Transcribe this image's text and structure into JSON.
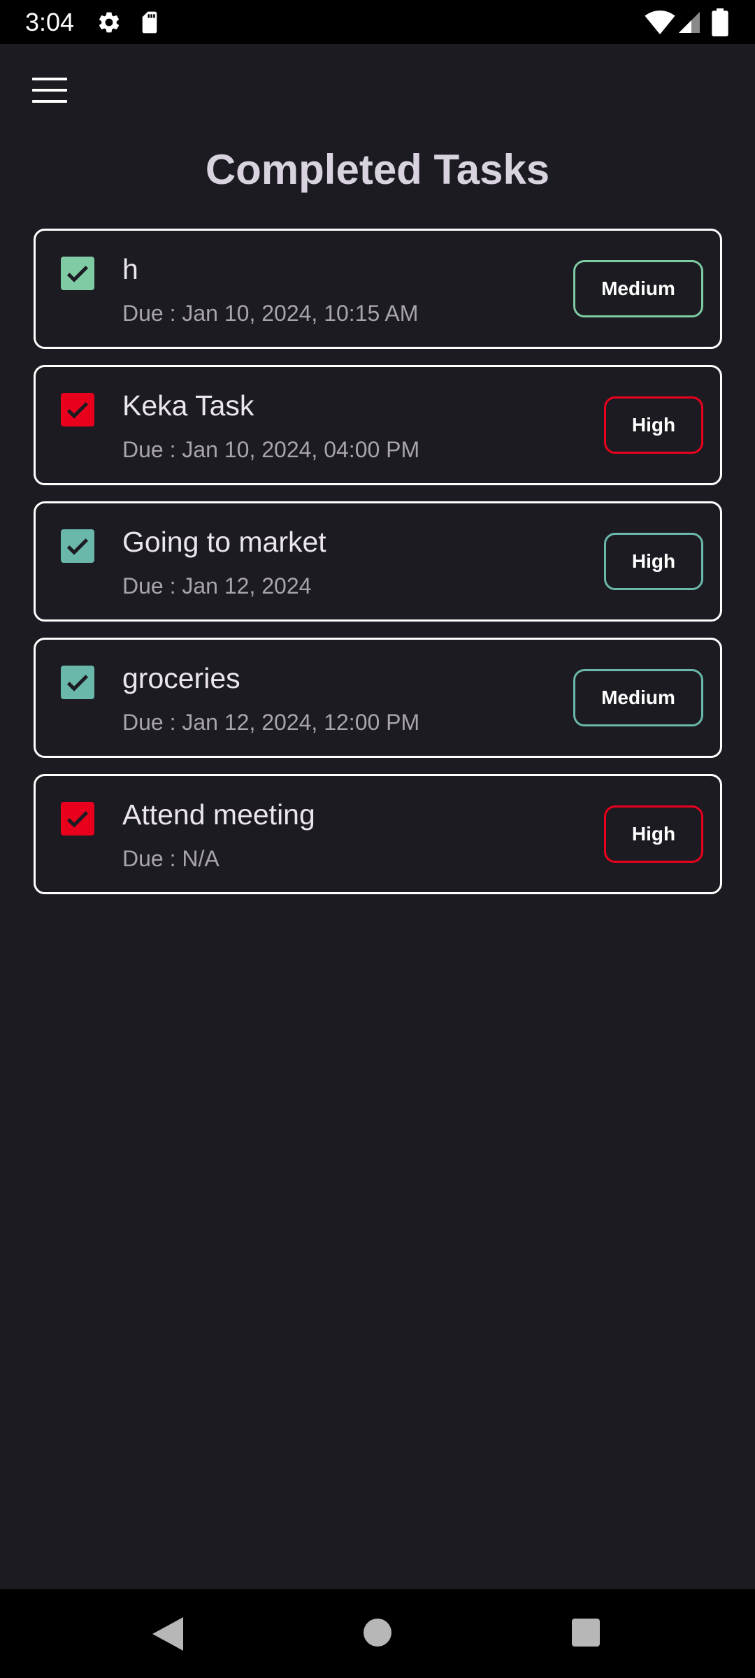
{
  "status_bar": {
    "time": "3:04",
    "icons": [
      "gear-icon",
      "sd-card-icon",
      "wifi-icon",
      "signal-icon",
      "battery-icon"
    ]
  },
  "app": {
    "menu_icon": "hamburger-menu-icon",
    "title": "Completed Tasks"
  },
  "colors": {
    "background": "#1c1b21",
    "green_check": "#7ecba4",
    "teal_check": "#69b8aa",
    "red_check": "#e8001c",
    "green_border": "#7ecba4",
    "teal_border": "#69b8aa",
    "red_border": "#e8001c"
  },
  "tasks": [
    {
      "title": "h",
      "due": "Due : Jan 10, 2024, 10:15 AM",
      "priority": "Medium",
      "checked": true,
      "check_color": "#7ecba4",
      "badge_color": "#7ecba4"
    },
    {
      "title": "Keka Task",
      "due": "Due : Jan 10, 2024, 04:00 PM",
      "priority": "High",
      "checked": true,
      "check_color": "#e8001c",
      "badge_color": "#e8001c"
    },
    {
      "title": "Going to market",
      "due": "Due : Jan 12, 2024",
      "priority": "High",
      "checked": true,
      "check_color": "#69b8aa",
      "badge_color": "#69b8aa"
    },
    {
      "title": "groceries",
      "due": "Due : Jan 12, 2024, 12:00 PM",
      "priority": "Medium",
      "checked": true,
      "check_color": "#69b8aa",
      "badge_color": "#69b8aa"
    },
    {
      "title": "Attend meeting",
      "due": "Due : N/A",
      "priority": "High",
      "checked": true,
      "check_color": "#e8001c",
      "badge_color": "#e8001c"
    }
  ],
  "nav_bar": {
    "icons": [
      "back-icon",
      "home-icon",
      "recents-icon"
    ]
  }
}
